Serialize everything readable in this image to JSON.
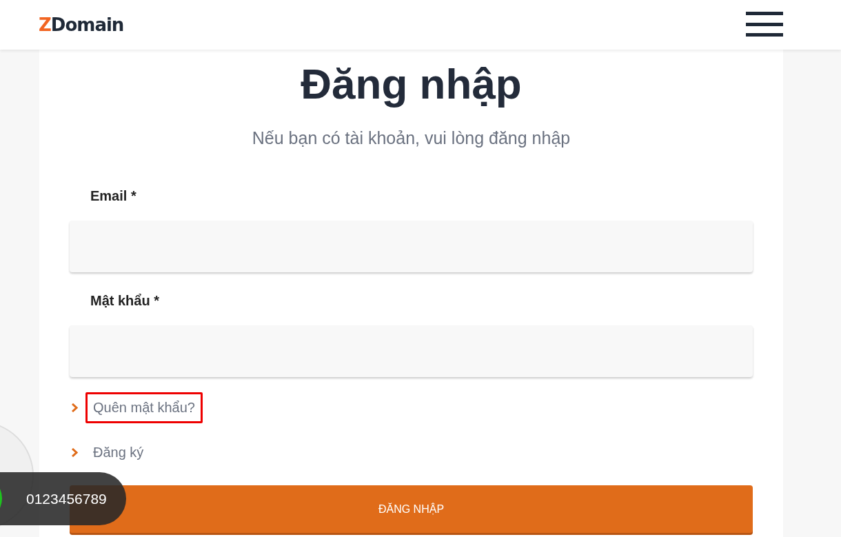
{
  "header": {
    "logo": {
      "accent": "Z",
      "rest": "Domain"
    }
  },
  "form": {
    "title": "Đăng nhập",
    "subtitle": "Nếu bạn có tài khoản, vui lòng đăng nhập",
    "fields": [
      {
        "label": "Email *"
      },
      {
        "label": "Mật khẩu *"
      }
    ],
    "links": [
      {
        "label": "Quên mật khẩu?",
        "highlighted": true
      },
      {
        "label": "Đăng ký",
        "highlighted": false
      }
    ],
    "submit": "ĐĂNG NHẬP"
  },
  "call_widget": {
    "phone": "0123456789"
  }
}
